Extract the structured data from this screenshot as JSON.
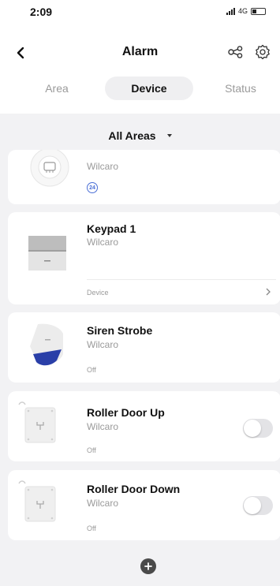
{
  "status_bar": {
    "time": "2:09",
    "network": "4G"
  },
  "nav": {
    "title": "Alarm",
    "back_icon": "chevron-left-icon",
    "share_icon": "share-nodes-icon",
    "settings_icon": "gear-icon"
  },
  "tabs": [
    {
      "label": "Area",
      "active": false
    },
    {
      "label": "Device",
      "active": true
    },
    {
      "label": "Status",
      "active": false
    }
  ],
  "area_filter": {
    "label": "All Areas"
  },
  "devices": [
    {
      "name": "",
      "location": "Wilcaro",
      "badge": "24",
      "icon": "round-sensor-icon"
    },
    {
      "name": "Keypad 1",
      "location": "Wilcaro",
      "link_label": "Device",
      "icon": "keypad-icon"
    },
    {
      "name": "Siren Strobe",
      "location": "Wilcaro",
      "state": "Off",
      "icon": "siren-strobe-icon"
    },
    {
      "name": "Roller Door Up",
      "location": "Wilcaro",
      "state": "Off",
      "toggle_on": false,
      "icon": "relay-module-icon"
    },
    {
      "name": "Roller Door Down",
      "location": "Wilcaro",
      "state": "Off",
      "toggle_on": false,
      "icon": "relay-module-icon"
    }
  ],
  "colors": {
    "accent_blue": "#4a6fd6",
    "siren_blue": "#2a3fa8",
    "background": "#f2f2f4"
  }
}
